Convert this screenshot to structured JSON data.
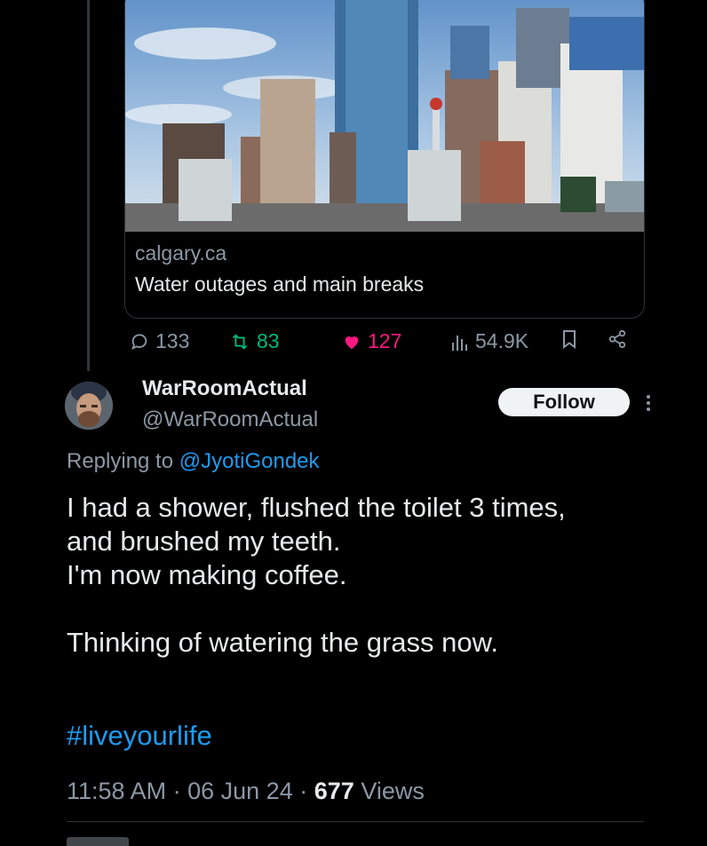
{
  "card": {
    "image_alt": "Calgary downtown skyline",
    "domain": "calgary.ca",
    "title": "Water outages and main breaks"
  },
  "metrics": {
    "replies": "133",
    "reposts": "83",
    "likes": "127",
    "views": "54.9K",
    "repost_color": "#00ba7c",
    "like_color": "#f91880"
  },
  "tweet": {
    "display_name": "WarRoomActual",
    "handle": "@WarRoomActual",
    "follow_label": "Follow",
    "replying_prefix": "Replying to ",
    "replying_to": "@JyotiGondek",
    "text": "I had a shower, flushed the toilet 3 times,\nand brushed my teeth.\nI'm now making coffee.\n\nThinking of watering the grass now.",
    "hashtag": "#liveyourlife",
    "time": "11:58 AM",
    "date": "06 Jun 24",
    "views_count": "677",
    "views_label": "Views"
  },
  "colors": {
    "background": "#000000",
    "link": "#1d9bf0",
    "secondary_text": "#8b98a5"
  }
}
